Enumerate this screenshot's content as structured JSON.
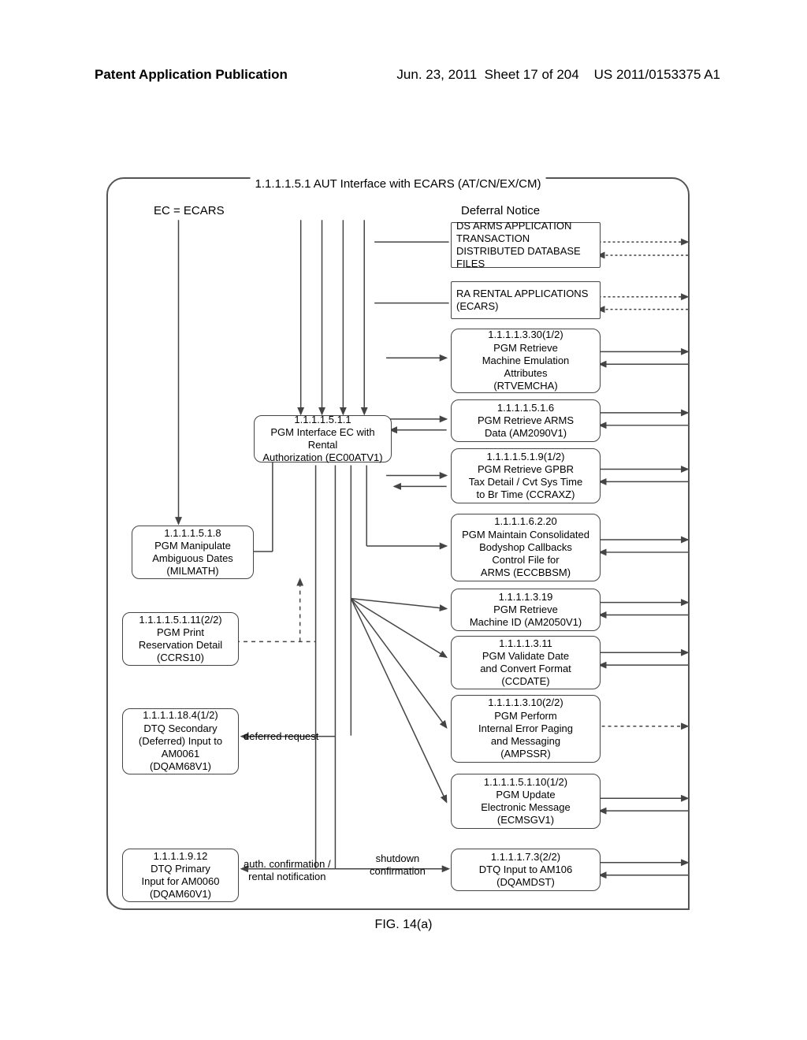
{
  "header": {
    "left": "Patent Application Publication",
    "date": "Jun. 23, 2011",
    "sheet": "Sheet 17 of 204",
    "pubno": "US 2011/0153375 A1"
  },
  "diagram": {
    "title": "1.1.1.1.5.1 AUT Interface with ECARS (AT/CN/EX/CM)",
    "ec_label": "EC = ECARS",
    "deferral": "Deferral Notice",
    "fig_caption": "FIG. 14(a)",
    "labels": {
      "deferred_request": "deferred request",
      "auth_conf": "auth. confirmation /\nrental notification",
      "shutdown": "shutdown\nconfirmation"
    },
    "boxes": {
      "ds_arms": "DS ARMS APPLICATION TRANSACTION DISTRIBUTED DATABASE FILES",
      "ra_rental": "RA RENTAL APPLICATIONS (ECARS)",
      "retrieve_emu": "1.1.1.1.3.30(1/2)\nPGM Retrieve\nMachine Emulation\nAttributes\n(RTVEMCHA)",
      "retrieve_arms": "1.1.1.1.5.1.6\nPGM Retrieve ARMS\nData (AM2090V1)",
      "retrieve_gpbr": "1.1.1.1.5.1.9(1/2)\nPGM Retrieve GPBR\nTax Detail / Cvt Sys Time\nto Br Time (CCRAXZ)",
      "pgm_interface": "1.1.1.1.5.1.1\nPGM Interface EC with Rental\nAuthorization (EC00ATV1)",
      "milmath": "1.1.1.1.5.1.8\nPGM Manipulate\nAmbiguous Dates\n(MILMATH)",
      "eccbbsm": "1.1.1.1.6.2.20\nPGM Maintain Consolidated\nBodyshop Callbacks\nControl File for\nARMS (ECCBBSM)",
      "ccrs10": "1.1.1.1.5.1.11(2/2)\nPGM Print\nReservation Detail\n(CCRS10)",
      "machine_id": "1.1.1.1.3.19\nPGM Retrieve\nMachine ID (AM2050V1)",
      "ccdate": "1.1.1.1.3.11\nPGM Validate Date\nand Convert Format\n(CCDATE)",
      "ampssr": "1.1.1.1.3.10(2/2)\nPGM Perform\nInternal Error Paging\nand Messaging\n(AMPSSR)",
      "dqam68": "1.1.1.1.18.4(1/2)\nDTQ Secondary\n(Deferred) Input to\nAM0061\n(DQAM68V1)",
      "ecmsgv1": "1.1.1.1.5.1.10(1/2)\nPGM Update\nElectronic Message\n(ECMSGV1)",
      "dqam60": "1.1.1.1.9.12\nDTQ Primary\nInput for AM0060\n(DQAM60V1)",
      "dqamdst": "1.1.1.1.7.3(2/2)\nDTQ Input to AM106\n(DQAMDST)"
    }
  }
}
